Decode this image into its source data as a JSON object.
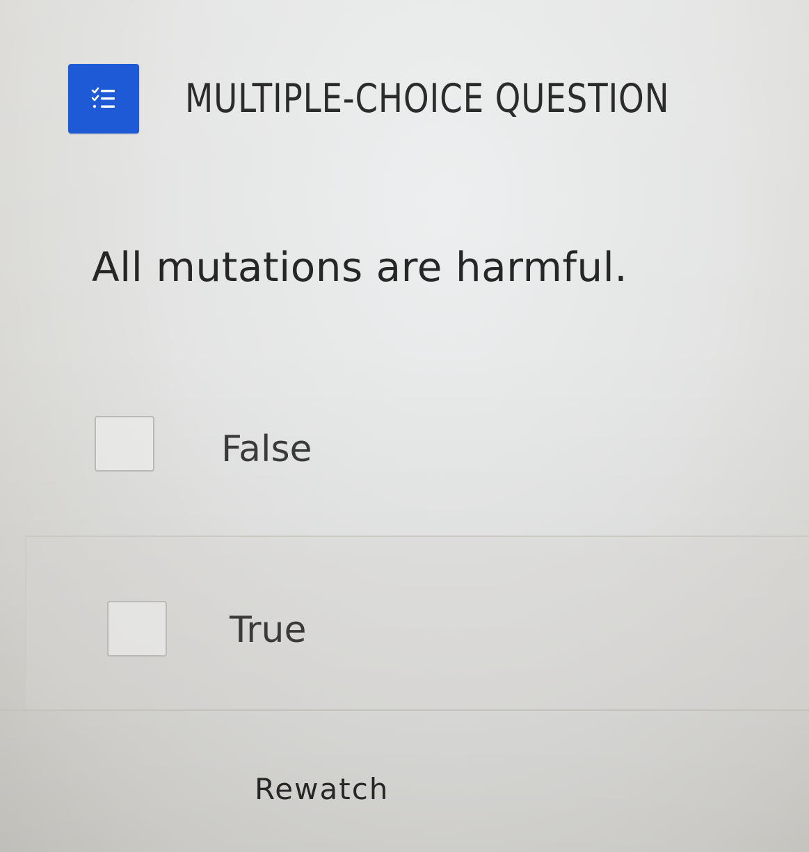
{
  "header": {
    "icon": "checklist-icon",
    "title": "MULTIPLE-CHOICE QUESTION",
    "accent_color": "#1e5ad6"
  },
  "question": {
    "text": "All mutations are harmful."
  },
  "options": [
    {
      "label": "False",
      "checked": false
    },
    {
      "label": "True",
      "checked": false
    }
  ],
  "footer": {
    "rewatch_label": "Rewatch"
  }
}
